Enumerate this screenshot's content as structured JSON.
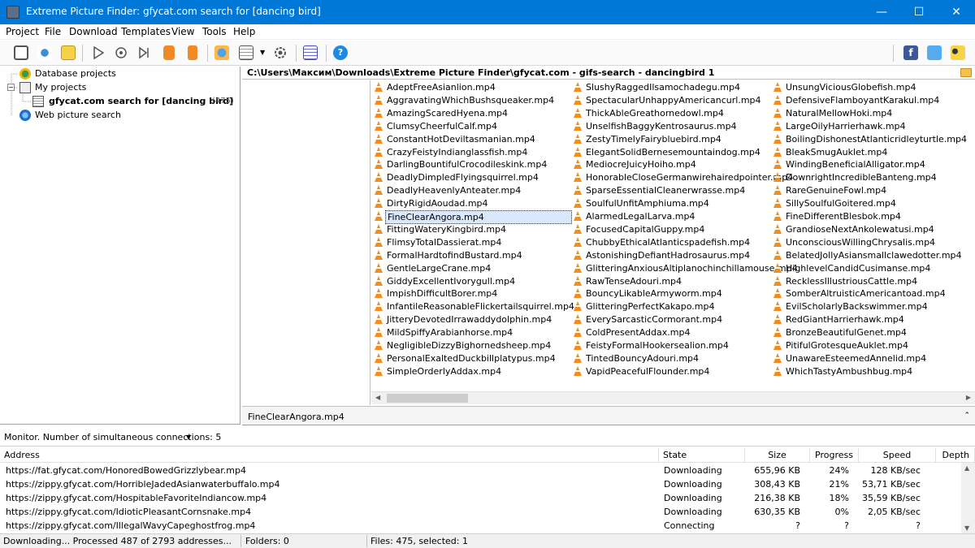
{
  "window": {
    "title": "Extreme Picture Finder: gfycat.com search for [dancing bird]",
    "minimize": "—",
    "maximize": "☐",
    "close": "✕"
  },
  "menu": [
    "Project",
    "File",
    "Download",
    "Templates",
    "View",
    "Tools",
    "Help"
  ],
  "tree": {
    "database_projects": "Database projects",
    "my_projects": "My projects",
    "project_name": "gfycat.com search for [dancing bird]",
    "project_count": "(475)",
    "web_search": "Web picture search"
  },
  "path": "C:\\Users\\Максим\\Downloads\\Extreme Picture Finder\\gfycat.com - gifs-search - dancingbird 1",
  "files": {
    "col1": [
      "AdeptFreeAsianlion.mp4",
      "AggravatingWhichBushsqueaker.mp4",
      "AmazingScaredHyena.mp4",
      "ClumsyCheerfulCalf.mp4",
      "ConstantHotDeviltasmanian.mp4",
      "CrazyFeistyIndianglassfish.mp4",
      "DarlingBountifulCrocodileskink.mp4",
      "DeadlyDimpledFlyingsquirrel.mp4",
      "DeadlyHeavenlyAnteater.mp4",
      "DirtyRigidAoudad.mp4",
      "FineClearAngora.mp4",
      "FittingWateryKingbird.mp4",
      "FlimsyTotalDassierat.mp4",
      "FormalHardtofindBustard.mp4",
      "GentleLargeCrane.mp4",
      "GiddyExcellentIvorygull.mp4",
      "ImpishDifficultBorer.mp4",
      "InfantileReasonableFlickertailsquirrel.mp4",
      "JitteryDevotedIrrawaddydolphin.mp4",
      "MildSpiffyArabianhorse.mp4",
      "NegligibleDizzyBighornedsheep.mp4",
      "PersonalExaltedDuckbillplatypus.mp4",
      "SimpleOrderlyAddax.mp4"
    ],
    "col2": [
      "SlushyRaggedIlsamochadegu.mp4",
      "SpectacularUnhappyAmericancurl.mp4",
      "ThickAbleGreathornedowl.mp4",
      "UnselfishBaggyKentrosaurus.mp4",
      "ZestyTimelyFairybluebird.mp4",
      "ElegantSolidBernesemountaindog.mp4",
      "MediocreJuicyHoiho.mp4",
      "HonorableCloseGermanwirehairedpointer.mp4",
      "SparseEssentialCleanerwrasse.mp4",
      "SoulfulUnfitAmphiuma.mp4",
      "AlarmedLegalLarva.mp4",
      "FocusedCapitalGuppy.mp4",
      "ChubbyEthicalAtlanticspadefish.mp4",
      "AstonishingDefiantHadrosaurus.mp4",
      "GlitteringAnxiousAltiplanochinchillamouse.mp4",
      "RawTenseAdouri.mp4",
      "BouncyLikableArmyworm.mp4",
      "GlitteringPerfectKakapo.mp4",
      "EverySarcasticCormorant.mp4",
      "ColdPresentAddax.mp4",
      "FeistyFormalHookersealion.mp4",
      "TintedBouncyAdouri.mp4",
      "VapidPeacefulFlounder.mp4"
    ],
    "col3": [
      "UnsungViciousGlobefish.mp4",
      "DefensiveFlamboyantKarakul.mp4",
      "NaturalMellowHoki.mp4",
      "LargeOilyHarrierhawk.mp4",
      "BoilingDishonestAtlanticridleyturtle.mp4",
      "BleakSmugAuklet.mp4",
      "WindingBeneficialAlligator.mp4",
      "DownrightIncredibleBanteng.mp4",
      "RareGenuineFowl.mp4",
      "SillySoulfulGoitered.mp4",
      "FineDifferentBlesbok.mp4",
      "GrandioseNextAnkolewatusi.mp4",
      "UnconsciousWillingChrysalis.mp4",
      "BelatedJollyAsiansmallclawedotter.mp4",
      "HighlevelCandidCusimanse.mp4",
      "RecklessIllustriousCattle.mp4",
      "SomberAltruisticAmericantoad.mp4",
      "EvilScholarlyBackswimmer.mp4",
      "RedGiantHarrierhawk.mp4",
      "BronzeBeautifulGenet.mp4",
      "PitifulGrotesqueAuklet.mp4",
      "UnawareEsteemedAnnelid.mp4",
      "WhichTastyAmbushbug.mp4"
    ]
  },
  "selected_file": "FineClearAngora.mp4",
  "monitor": "Monitor. Number of simultaneous connections: 5",
  "table": {
    "headers": [
      "Address",
      "State",
      "Size",
      "Progress",
      "Speed",
      "Depth"
    ],
    "rows": [
      {
        "address": "https://fat.gfycat.com/HonoredBowedGrizzlybear.mp4",
        "state": "Downloading",
        "size": "655,96 KB",
        "progress": "24%",
        "speed": "128 KB/sec",
        "depth": "3"
      },
      {
        "address": "https://zippy.gfycat.com/HorribleJadedAsianwaterbuffalo.mp4",
        "state": "Downloading",
        "size": "308,43 KB",
        "progress": "21%",
        "speed": "53,71 KB/sec",
        "depth": "3"
      },
      {
        "address": "https://zippy.gfycat.com/HospitableFavoriteIndiancow.mp4",
        "state": "Downloading",
        "size": "216,38 KB",
        "progress": "18%",
        "speed": "35,59 KB/sec",
        "depth": "3"
      },
      {
        "address": "https://zippy.gfycat.com/IdioticPleasantCornsnake.mp4",
        "state": "Downloading",
        "size": "630,35 KB",
        "progress": "0%",
        "speed": "2,05 KB/sec",
        "depth": "3"
      },
      {
        "address": "https://zippy.gfycat.com/IllegalWavyCapeghostfrog.mp4",
        "state": "Connecting",
        "size": "?",
        "progress": "?",
        "speed": "?",
        "depth": "3"
      }
    ]
  },
  "status": {
    "left": "Downloading... Processed 487 of 2793 addresses...",
    "folders": "Folders: 0",
    "files": "Files: 475, selected: 1"
  },
  "colors": {
    "titlebar": "#0078d7",
    "file_icon": "#f28c1c"
  }
}
